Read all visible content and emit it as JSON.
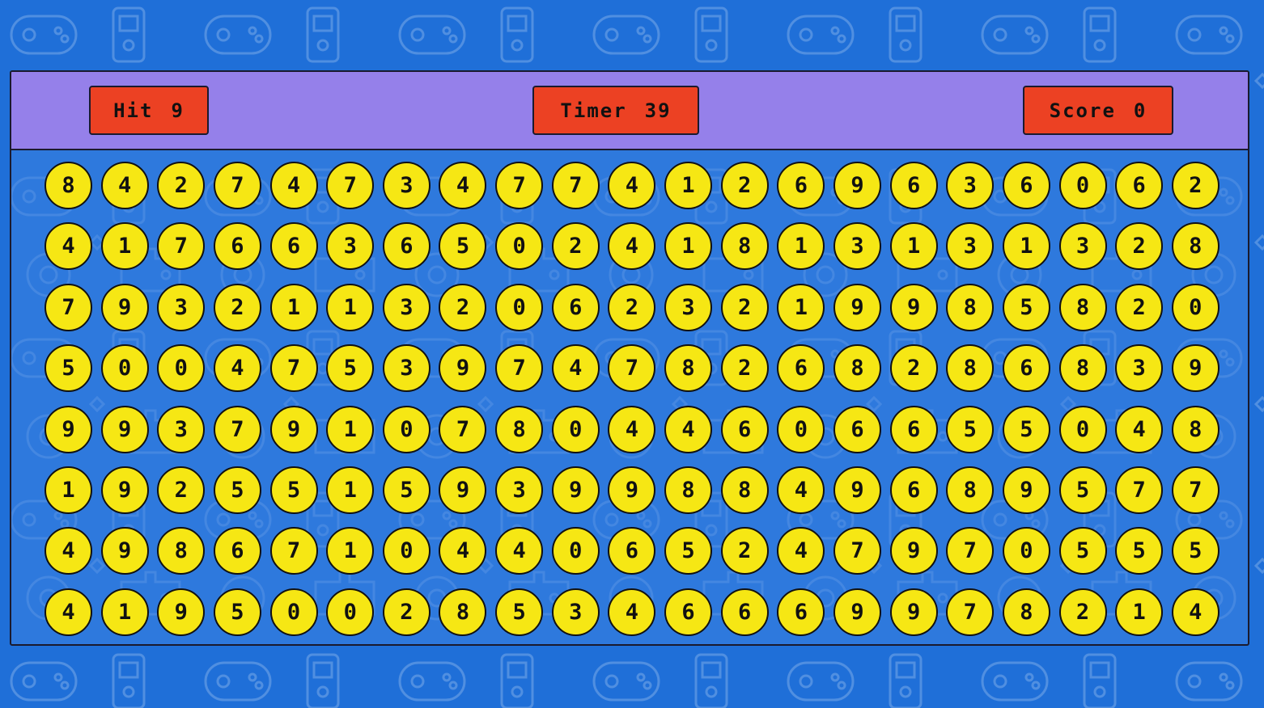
{
  "colors": {
    "background": "#1f6fd8",
    "header": "#9580ea",
    "stat_box": "#ec4123",
    "bubble": "#f6e714",
    "outline": "#111111"
  },
  "stats": {
    "hit_label": "Hit",
    "hit_value": "9",
    "timer_label": "Timer",
    "timer_value": "39",
    "score_label": "Score",
    "score_value": "0"
  },
  "grid": [
    [
      "8",
      "4",
      "2",
      "7",
      "4",
      "7",
      "3",
      "4",
      "7",
      "7",
      "4",
      "1",
      "2",
      "6",
      "9",
      "6",
      "3",
      "6",
      "0",
      "6",
      "2"
    ],
    [
      "4",
      "1",
      "7",
      "6",
      "6",
      "3",
      "6",
      "5",
      "0",
      "2",
      "4",
      "1",
      "8",
      "1",
      "3",
      "1",
      "3",
      "1",
      "3",
      "2",
      "8"
    ],
    [
      "7",
      "9",
      "3",
      "2",
      "1",
      "1",
      "3",
      "2",
      "0",
      "6",
      "2",
      "3",
      "2",
      "1",
      "9",
      "9",
      "8",
      "5",
      "8",
      "2",
      "0"
    ],
    [
      "5",
      "0",
      "0",
      "4",
      "7",
      "5",
      "3",
      "9",
      "7",
      "4",
      "7",
      "8",
      "2",
      "6",
      "8",
      "2",
      "8",
      "6",
      "8",
      "3",
      "9"
    ],
    [
      "9",
      "9",
      "3",
      "7",
      "9",
      "1",
      "0",
      "7",
      "8",
      "0",
      "4",
      "4",
      "6",
      "0",
      "6",
      "6",
      "5",
      "5",
      "0",
      "4",
      "8"
    ],
    [
      "1",
      "9",
      "2",
      "5",
      "5",
      "1",
      "5",
      "9",
      "3",
      "9",
      "9",
      "8",
      "8",
      "4",
      "9",
      "6",
      "8",
      "9",
      "5",
      "7",
      "7"
    ],
    [
      "4",
      "9",
      "8",
      "6",
      "7",
      "1",
      "0",
      "4",
      "4",
      "0",
      "6",
      "5",
      "2",
      "4",
      "7",
      "9",
      "7",
      "0",
      "5",
      "5",
      "5"
    ],
    [
      "4",
      "1",
      "9",
      "5",
      "0",
      "0",
      "2",
      "8",
      "5",
      "3",
      "4",
      "6",
      "6",
      "6",
      "9",
      "9",
      "7",
      "8",
      "2",
      "1",
      "4"
    ]
  ]
}
